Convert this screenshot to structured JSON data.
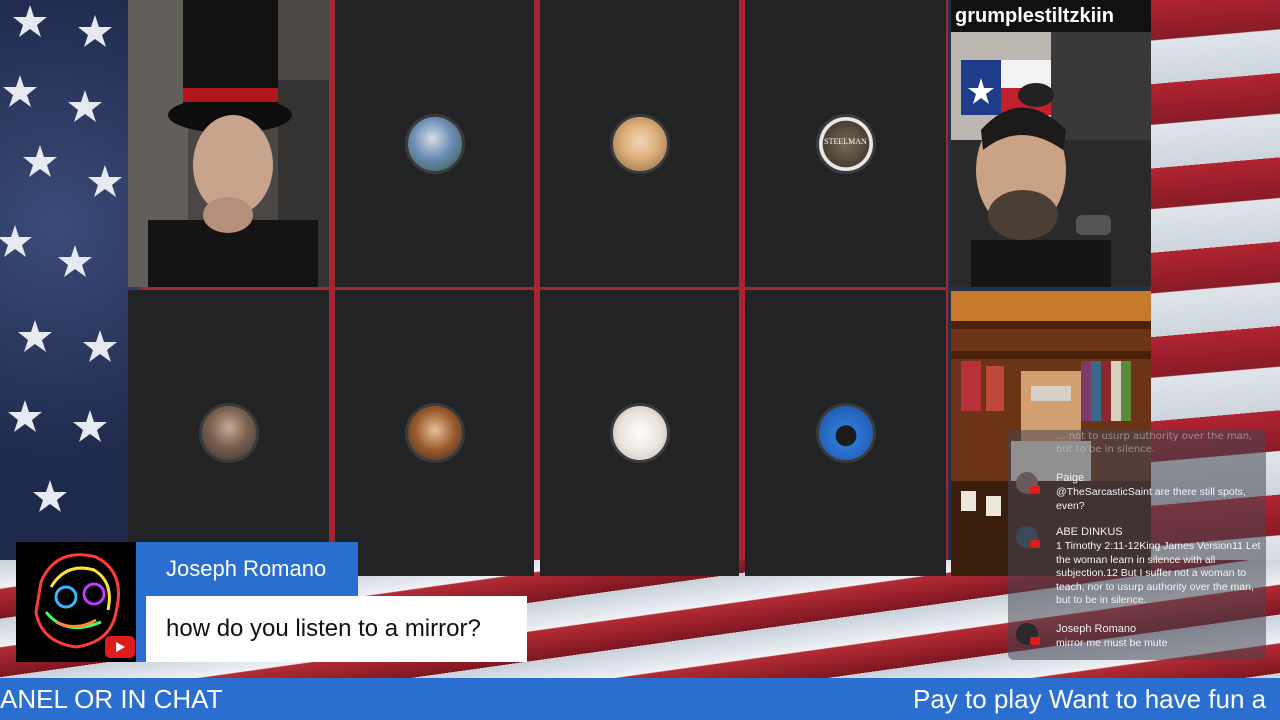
{
  "stream": {
    "right_camera_name": "grumplestiltzkiin"
  },
  "participants": [
    {
      "tile": 1,
      "type": "camera",
      "description": "man-top-hat"
    },
    {
      "tile": 2,
      "type": "avatar"
    },
    {
      "tile": 3,
      "type": "avatar"
    },
    {
      "tile": 4,
      "type": "avatar",
      "avatar_text": "STEELMAN"
    },
    {
      "tile": 5,
      "type": "avatar"
    },
    {
      "tile": 6,
      "type": "avatar"
    },
    {
      "tile": 7,
      "type": "avatar"
    },
    {
      "tile": 8,
      "type": "avatar"
    }
  ],
  "chat": {
    "faded_text": "... not to usurp authority over the man, but to be in silence.",
    "messages": [
      {
        "author": "Paige",
        "text": "@TheSarcasticSaint are there still spots, even?"
      },
      {
        "author": "ABE DINKUS",
        "text": "1 Timothy 2:11-12King James Version11 Let the woman learn in silence with all subjection.12 But I suffer not a woman to teach, nor to usurp authority over the man, but to be in silence."
      },
      {
        "author": "Joseph Romano",
        "text": "mirror me must be mute"
      }
    ]
  },
  "lower_third": {
    "name": "Joseph Romano",
    "message": "how do you listen to a mirror?"
  },
  "ticker": {
    "left_text": "ANEL OR IN CHAT",
    "right_text": "Pay to play Want to have fun a"
  },
  "colors": {
    "accent_blue": "#2a6ecf",
    "tile_bg": "#222324",
    "youtube_red": "#e01b1b"
  }
}
